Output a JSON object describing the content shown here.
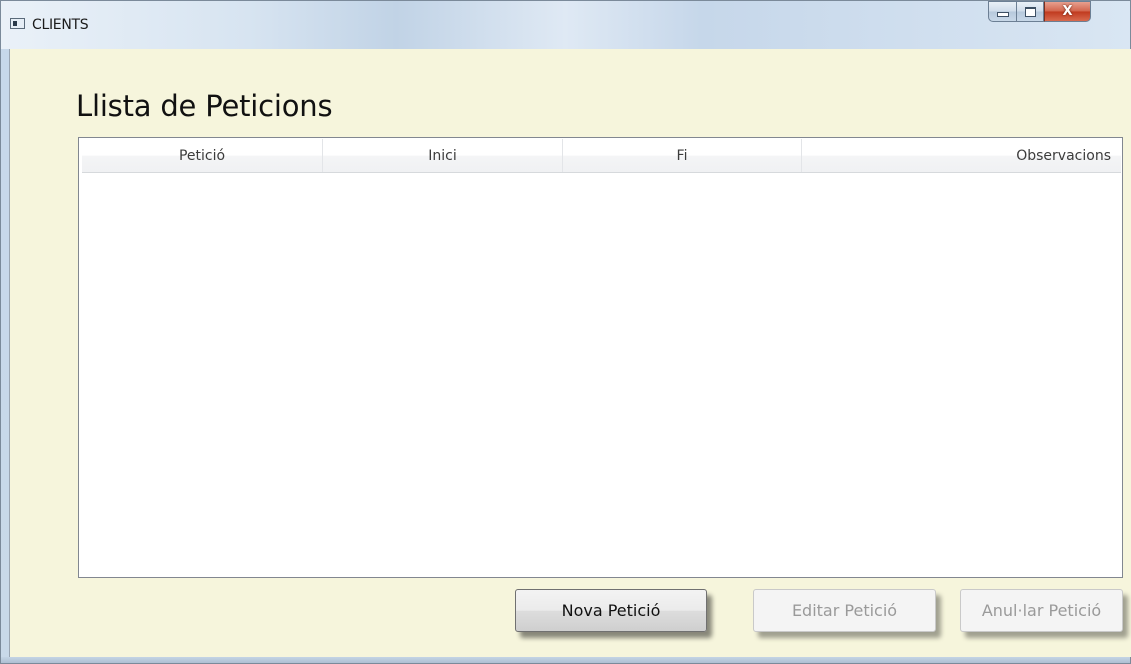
{
  "window": {
    "title": "CLIENTS",
    "close_glyph": "X",
    "icons": {
      "app": "window-app-icon",
      "minimize": "minimize-icon",
      "maximize": "maximize-icon",
      "close": "close-icon"
    }
  },
  "main": {
    "title": "Llista de Peticions",
    "list": {
      "columns": [
        "Petició",
        "Inici",
        "Fi",
        "Observacions"
      ],
      "rows": []
    }
  },
  "buttons": {
    "new": {
      "label": "Nova Petició",
      "enabled": true
    },
    "edit": {
      "label": "Editar Petició",
      "enabled": false
    },
    "cancel": {
      "label": "Anul·lar Petició",
      "enabled": false
    }
  },
  "colors": {
    "client_background": "#f6f5dc",
    "close_button": "#c0391e"
  }
}
